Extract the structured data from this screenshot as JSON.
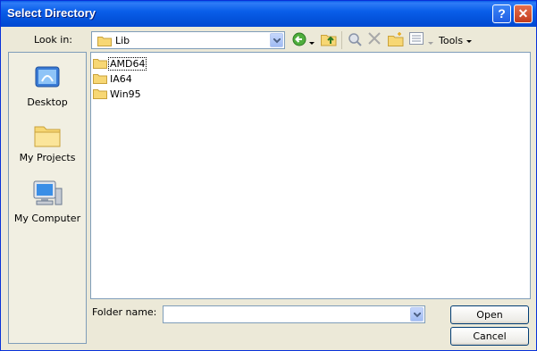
{
  "window": {
    "title": "Select Directory"
  },
  "lookin": {
    "label": "Look in:",
    "value": "Lib"
  },
  "toolbar": {
    "icons": [
      "back-icon",
      "up-folder-icon",
      "search-web-icon",
      "delete-icon",
      "new-folder-icon",
      "views-icon"
    ],
    "tools_label": "Tools"
  },
  "places": [
    {
      "label": "Desktop",
      "icon": "desktop-icon"
    },
    {
      "label": "My Projects",
      "icon": "folder-icon"
    },
    {
      "label": "My Computer",
      "icon": "my-computer-icon"
    }
  ],
  "files": [
    {
      "name": "AMD64",
      "focused": true
    },
    {
      "name": "IA64"
    },
    {
      "name": "Win95"
    }
  ],
  "folder_name": {
    "label": "Folder name:",
    "value": ""
  },
  "buttons": {
    "open": "Open",
    "cancel": "Cancel"
  },
  "colors": {
    "titlebar": "#0a5ee9",
    "dialog_bg": "#ece9d8",
    "border": "#7f9db9"
  }
}
